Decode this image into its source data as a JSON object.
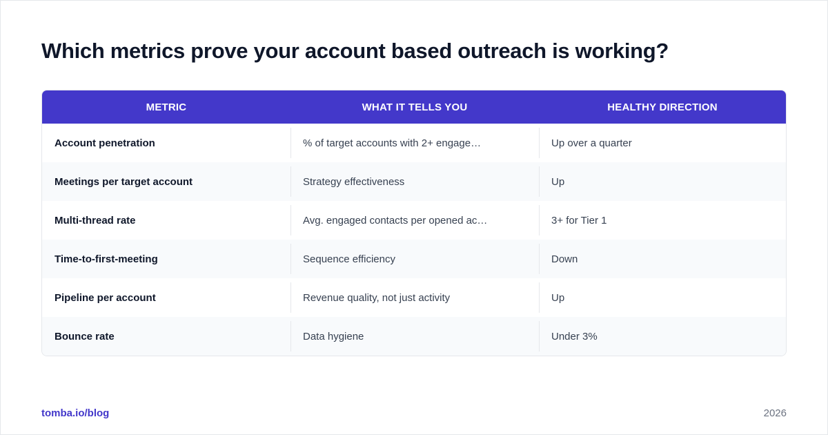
{
  "title": "Which metrics prove your account based outreach is working?",
  "table": {
    "headers": [
      "METRIC",
      "WHAT IT TELLS YOU",
      "HEALTHY DIRECTION"
    ],
    "rows": [
      [
        "Account penetration",
        "% of target accounts with 2+ engage…",
        "Up over a quarter"
      ],
      [
        "Meetings per target account",
        "Strategy effectiveness",
        "Up"
      ],
      [
        "Multi-thread rate",
        "Avg. engaged contacts per opened ac…",
        "3+ for Tier 1"
      ],
      [
        "Time-to-first-meeting",
        "Sequence efficiency",
        "Down"
      ],
      [
        "Pipeline per account",
        "Revenue quality, not just activity",
        "Up"
      ],
      [
        "Bounce rate",
        "Data hygiene",
        "Under 3%"
      ]
    ]
  },
  "footer": {
    "source": "tomba.io/blog",
    "year": "2026"
  },
  "colors": {
    "header_bg": "#4338ca",
    "title_text": "#0f172a",
    "link": "#4338ca",
    "row_alt": "#f8fafc"
  }
}
